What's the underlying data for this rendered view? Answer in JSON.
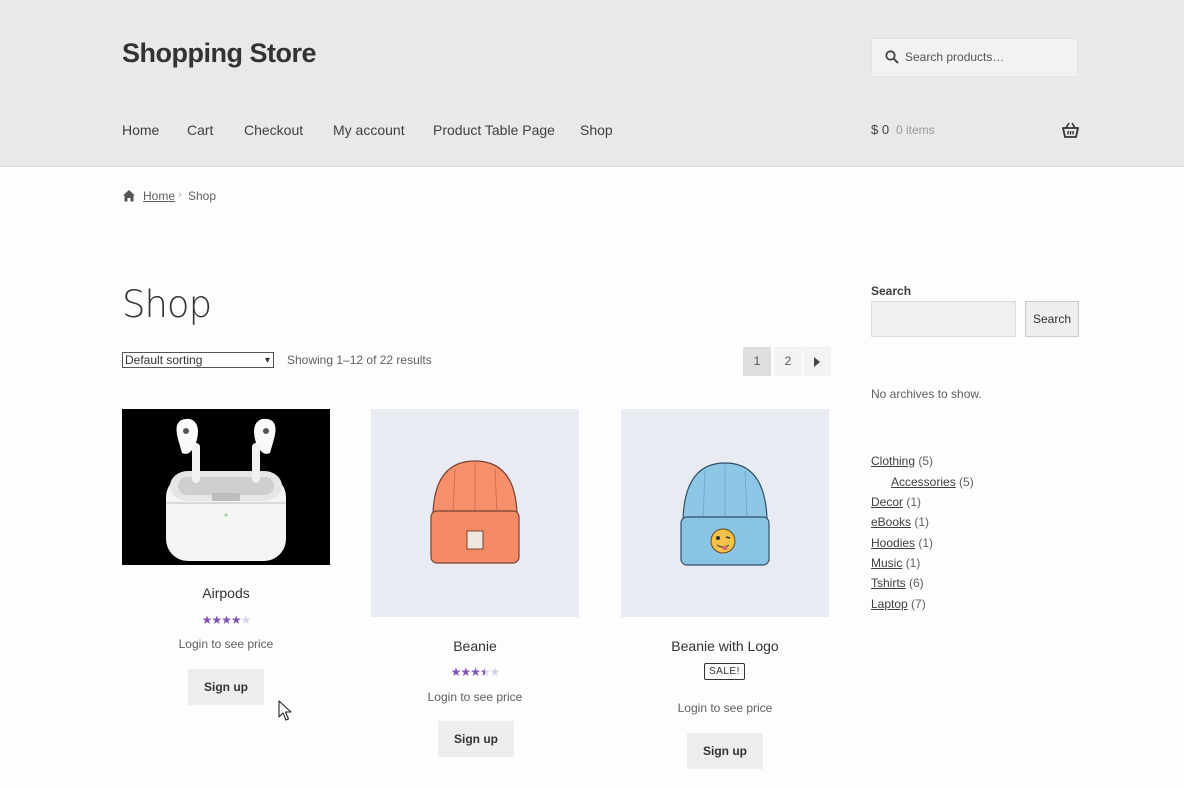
{
  "header": {
    "site_title": "Shopping Store",
    "search_placeholder": "Search products…",
    "nav": [
      "Home",
      "Cart",
      "Checkout",
      "My account",
      "Product Table Page",
      "Shop"
    ],
    "cart_total": "$ 0",
    "cart_count": "0 items"
  },
  "breadcrumb": {
    "home": "Home",
    "separator": "›",
    "current": "Shop"
  },
  "main": {
    "title": "Shop",
    "sort_value": "Default sorting",
    "result_count": "Showing 1–12 of 22 results",
    "pagination": {
      "current": "1",
      "next_page": "2",
      "next_icon": "caret-right-icon"
    },
    "products": [
      {
        "name": "Airpods",
        "rating": 4,
        "rating_max": 5,
        "price_text": "Login to see price",
        "button": "Sign up",
        "sale": null
      },
      {
        "name": "Beanie",
        "rating": 3.5,
        "rating_max": 5,
        "price_text": "Login to see price",
        "button": "Sign up",
        "sale": null
      },
      {
        "name": "Beanie with Logo",
        "rating": null,
        "rating_max": 5,
        "price_text": "Login to see price",
        "button": "Sign up",
        "sale": "SALE!"
      }
    ]
  },
  "sidebar": {
    "search_label": "Search",
    "search_button": "Search",
    "archives_text": "No archives to show.",
    "categories": [
      {
        "name": "Clothing",
        "count": "(5)"
      },
      {
        "name": "Accessories",
        "count": "(5)"
      },
      {
        "name": "Decor",
        "count": "(1)"
      },
      {
        "name": "eBooks",
        "count": "(1)"
      },
      {
        "name": "Hoodies",
        "count": "(1)"
      },
      {
        "name": "Music",
        "count": "(1)"
      },
      {
        "name": "Tshirts",
        "count": "(6)"
      },
      {
        "name": "Laptop",
        "count": "(7)"
      }
    ]
  },
  "colors": {
    "header_bg": "#e9e9e9",
    "star": "#7f54b3",
    "accent_text": "#333333"
  }
}
